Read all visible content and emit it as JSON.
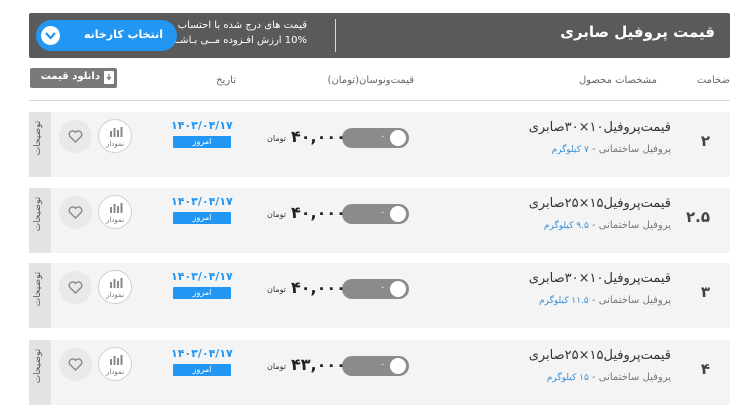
{
  "header": {
    "title": "قیمت پروفیل صابری",
    "notice_line1": "قیمت های درج شده با احتساب",
    "notice_line2": "10% ارزش افـزوده مــی بـاشـد.",
    "factory_button": "انتخاب کارخانه"
  },
  "columns": {
    "thickness": "ضخامت",
    "specs": "مشخصات محصول",
    "price": "قیمت‌ونوسان(تومان)",
    "date": "تاریخ"
  },
  "download_button": "دانلود قیمت",
  "icons": {
    "chevron": "chevron-down-icon",
    "download": "download-icon",
    "chart": "bar-chart-icon",
    "favorite": "heart-icon"
  },
  "colors": {
    "accent": "#2196f3",
    "header_bg": "#5a5a5a",
    "weight_text": "#3a8fd8"
  },
  "rows": [
    {
      "thickness": "۲",
      "name": "قیمت‌پروفیل۱۰×۳۰صابری",
      "spec": "پروفیل ساختمانی - ",
      "weight": "۷ کیلوگرم",
      "change": "۰",
      "price": "۴۰,۰۰۰",
      "unit": "تومان",
      "date": "۱۴۰۳/۰۴/۱۷",
      "today": "امروز",
      "chart_label": "نمودار",
      "side_label": "توضیحات"
    },
    {
      "thickness": "۲.۵",
      "name": "قیمت‌پروفیل۱۵×۲۵صابری",
      "spec": "پروفیل ساختمانی - ",
      "weight": "۹.۵ کیلوگرم",
      "change": "۰",
      "price": "۴۰,۰۰۰",
      "unit": "تومان",
      "date": "۱۴۰۳/۰۴/۱۷",
      "today": "امروز",
      "chart_label": "نمودار",
      "side_label": "توضیحات"
    },
    {
      "thickness": "۳",
      "name": "قیمت‌پروفیل۱۰×۳۰صابری",
      "spec": "پروفیل ساختمانی - ",
      "weight": "۱۱.۵ کیلوگرم",
      "change": "۰",
      "price": "۴۰,۰۰۰",
      "unit": "تومان",
      "date": "۱۴۰۳/۰۴/۱۷",
      "today": "امروز",
      "chart_label": "نمودار",
      "side_label": "توضیحات"
    },
    {
      "thickness": "۴",
      "name": "قیمت‌پروفیل۱۵×۲۵صابری",
      "spec": "پروفیل ساختمانی - ",
      "weight": "۱۵ کیلوگرم",
      "change": "۰",
      "price": "۴۳,۰۰۰",
      "unit": "تومان",
      "date": "۱۴۰۳/۰۴/۱۷",
      "today": "امروز",
      "chart_label": "نمودار",
      "side_label": "توضیحات"
    }
  ]
}
